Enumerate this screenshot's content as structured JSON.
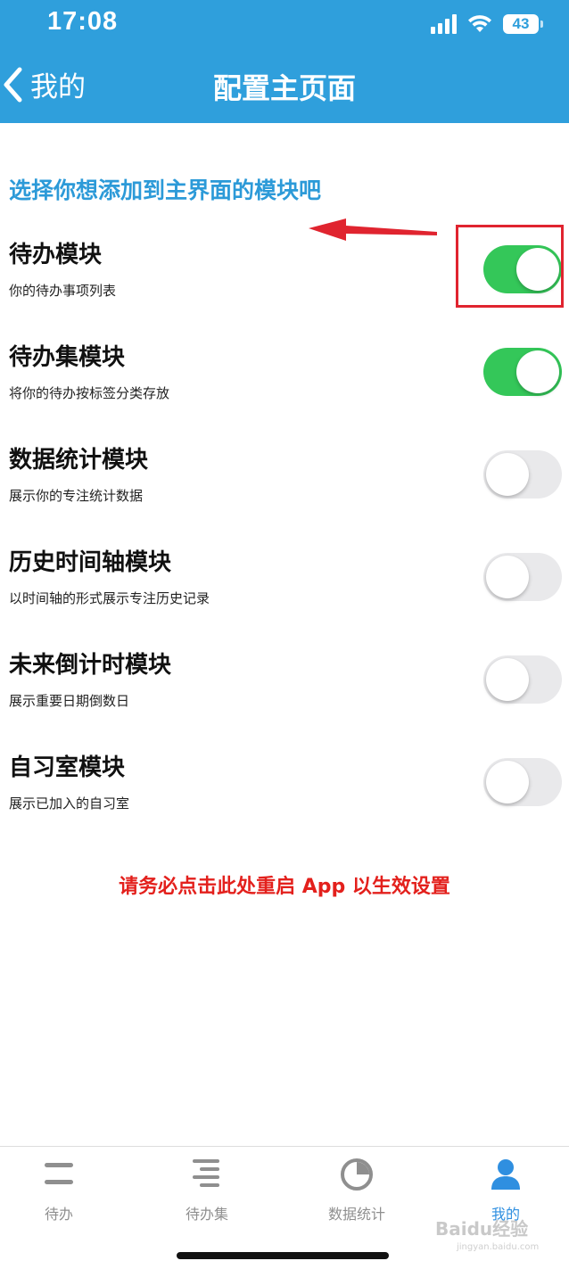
{
  "status_bar": {
    "time": "17:08",
    "battery": "43"
  },
  "nav": {
    "back_label": "我的",
    "title": "配置主页面"
  },
  "subtitle": "选择你想添加到主界面的模块吧",
  "modules": [
    {
      "title": "待办模块",
      "description": "你的待办事项列表",
      "enabled": true
    },
    {
      "title": "待办集模块",
      "description": "将你的待办按标签分类存放",
      "enabled": true
    },
    {
      "title": "数据统计模块",
      "description": "展示你的专注统计数据",
      "enabled": false
    },
    {
      "title": "历史时间轴模块",
      "description": "以时间轴的形式展示专注历史记录",
      "enabled": false
    },
    {
      "title": "未来倒计时模块",
      "description": "展示重要日期倒数日",
      "enabled": false
    },
    {
      "title": "自习室模块",
      "description": "展示已加入的自习室",
      "enabled": false
    }
  ],
  "restart_notice": "请务必点击此处重启 App 以生效设置",
  "tabbar": {
    "tabs": [
      {
        "label": "待办",
        "icon": "todo-lines-icon",
        "active": false
      },
      {
        "label": "待办集",
        "icon": "todo-set-icon",
        "active": false
      },
      {
        "label": "数据统计",
        "icon": "pie-chart-icon",
        "active": false
      },
      {
        "label": "我的",
        "icon": "person-icon",
        "active": true
      }
    ]
  },
  "watermark": {
    "text": "Baidu经验",
    "sub": "jingyan.baidu.com"
  },
  "colors": {
    "header": "#2f9fdc",
    "accent_text": "#2c9ad8",
    "switch_on": "#34c759",
    "switch_off": "#e9e9eb",
    "annotation_red": "#e0242f",
    "tab_active": "#2f8fe0"
  }
}
